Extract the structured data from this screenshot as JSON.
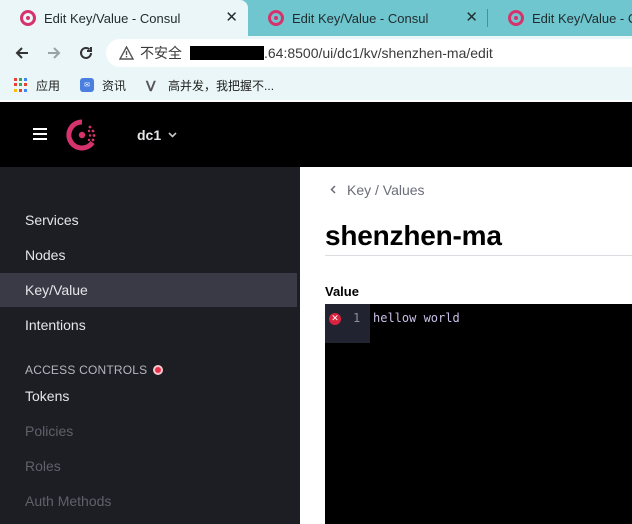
{
  "browser": {
    "tabs": [
      {
        "title": "Edit Key/Value - Consul",
        "close": "✕"
      },
      {
        "title": "Edit Key/Value - Consul",
        "close": "✕"
      },
      {
        "title": "Edit Key/Value - Consul"
      }
    ],
    "address": {
      "security_label": "不安全",
      "url": ".64:8500/ui/dc1/kv/shenzhen-ma/edit"
    },
    "bookmarks": [
      {
        "label": "应用",
        "icon": "apps-grid-icon"
      },
      {
        "label": "资讯",
        "icon": "news-icon"
      },
      {
        "label": "高并发，我把握不...",
        "icon": "v-icon"
      }
    ]
  },
  "header": {
    "datacenter": "dc1"
  },
  "sidebar": {
    "items": [
      {
        "label": "Services"
      },
      {
        "label": "Nodes"
      },
      {
        "label": "Key/Value",
        "active": true
      },
      {
        "label": "Intentions"
      }
    ],
    "access_controls_heading": "ACCESS CONTROLS",
    "acl_items": [
      {
        "label": "Tokens"
      },
      {
        "label": "Policies",
        "disabled": true
      },
      {
        "label": "Roles",
        "disabled": true
      },
      {
        "label": "Auth Methods",
        "disabled": true
      }
    ]
  },
  "main": {
    "breadcrumb": "Key / Values",
    "title": "shenzhen-ma",
    "field_label": "Value",
    "editor": {
      "line_number": "1",
      "content": "hellow world",
      "error_mark": "✕"
    }
  },
  "colors": {
    "brand": "#d6336c",
    "sidebar_bg": "#1d1e24",
    "sidebar_active": "#393a45",
    "error": "#d8233e"
  }
}
